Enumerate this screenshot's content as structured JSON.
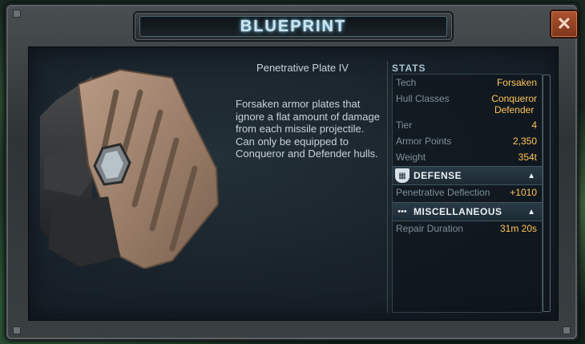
{
  "window": {
    "title": "BLUEPRINT",
    "close_label": "✕"
  },
  "item": {
    "name": "Penetrative Plate IV",
    "description": "Forsaken armor plates that ignore a flat amount of damage from each missile projectile.  Can only be equipped to Conqueror and Defender hulls."
  },
  "stats": {
    "header": "STATS",
    "rows": [
      {
        "label": "Tech",
        "value": "Forsaken"
      },
      {
        "label": "Hull Classes",
        "value": "Conqueror\nDefender"
      },
      {
        "label": "Tier",
        "value": "4"
      },
      {
        "label": "Armor Points",
        "value": "2,350"
      },
      {
        "label": "Weight",
        "value": "354t"
      }
    ],
    "sections": [
      {
        "title": "DEFENSE",
        "icon": "shield-icon",
        "rows": [
          {
            "label": "Penetrative Deflection",
            "value": "+1010"
          }
        ]
      },
      {
        "title": "MISCELLANEOUS",
        "icon": "dots-icon",
        "rows": [
          {
            "label": "Repair Duration",
            "value": "31m 20s"
          }
        ]
      }
    ]
  },
  "colors": {
    "value": "#ffc45a",
    "label": "#7f8f98",
    "title_glow": "#6fb8d8",
    "close": "#b05530"
  }
}
